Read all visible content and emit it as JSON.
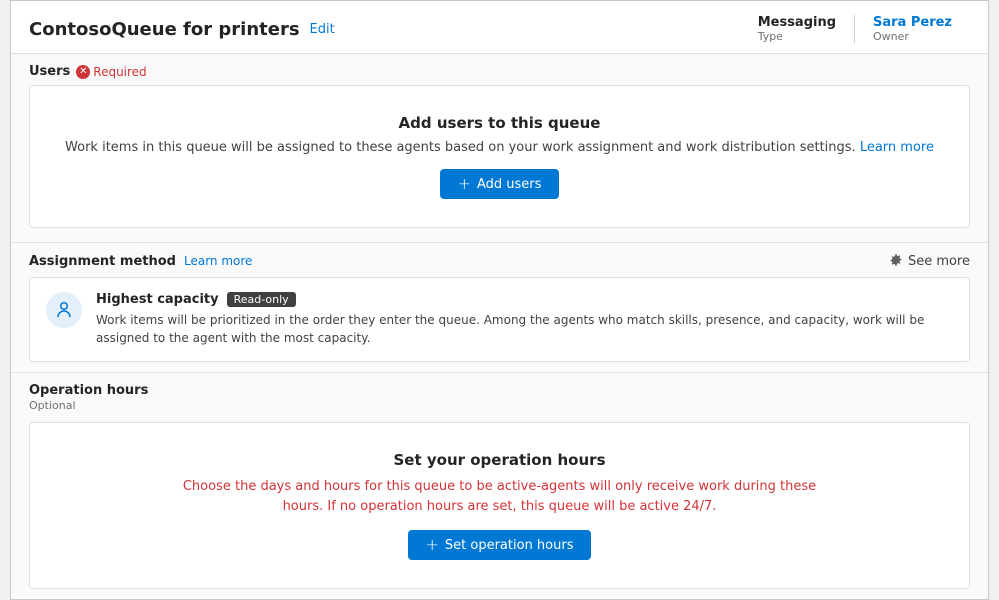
{
  "header": {
    "title": "ContosoQueue for printers",
    "edit_label": "Edit",
    "meta": [
      {
        "value": "Messaging",
        "label": "Type"
      },
      {
        "value": "Sara Perez",
        "label": "Owner"
      }
    ]
  },
  "users_section": {
    "label": "Users",
    "required_text": "Required",
    "card": {
      "title": "Add users to this queue",
      "desc_before": "Work items in this queue will be assigned to these agents based on your work assignment and work distribution settings.",
      "learn_more": "Learn more",
      "add_users_btn": "+ Add users"
    }
  },
  "assignment_section": {
    "label": "Assignment method",
    "learn_more": "Learn more",
    "see_more": "See more",
    "method": {
      "title": "Highest capacity",
      "badge": "Read-only",
      "desc": "Work items will be prioritized in the order they enter the queue. Among the agents who match skills, presence, and capacity, work will be assigned to the agent with the most capacity."
    }
  },
  "operation_section": {
    "label": "Operation hours",
    "optional": "Optional",
    "card": {
      "title": "Set your operation hours",
      "desc_line1": "Choose the days and hours for this queue to be active-agents will only receive work during these",
      "desc_line2": "hours. If no operation hours are set, this queue will be active 24/7.",
      "btn": "Set operation hours"
    }
  },
  "icons": {
    "gear": "⚙",
    "plus": "+"
  }
}
